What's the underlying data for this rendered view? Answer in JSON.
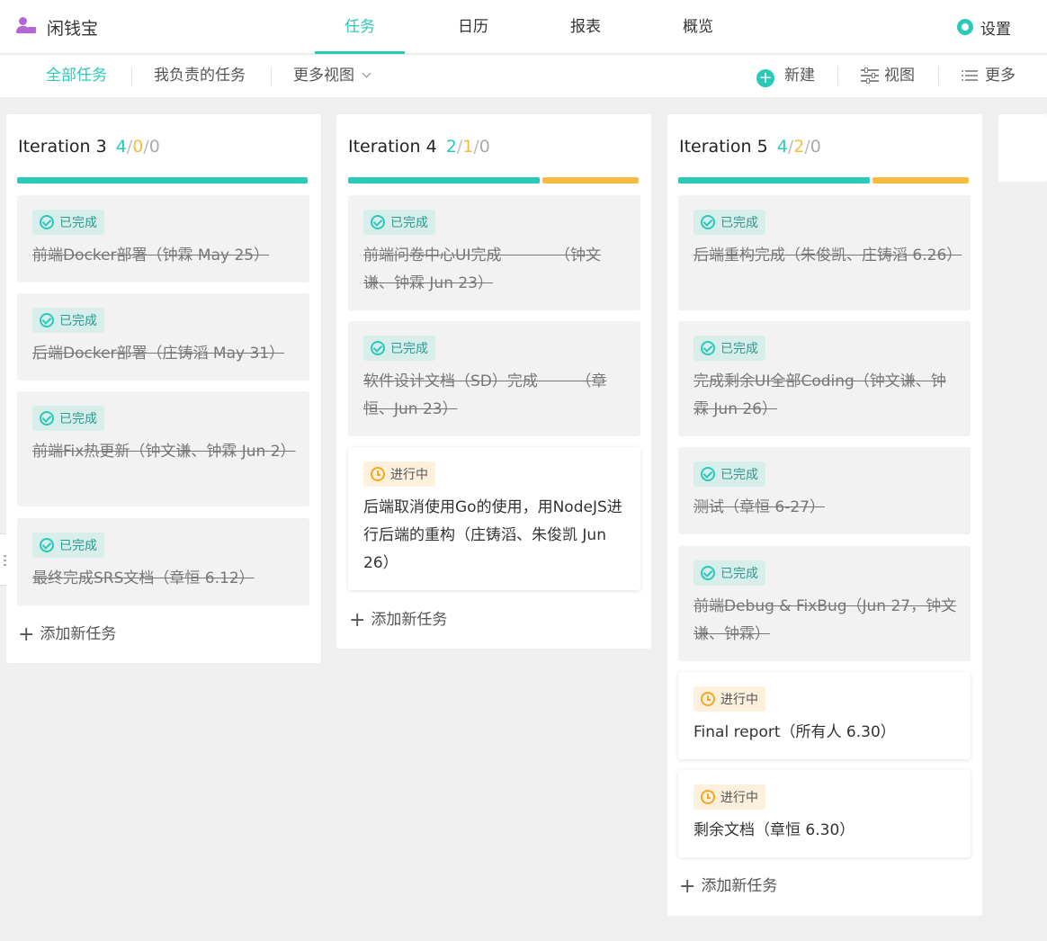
{
  "brand": {
    "name": "闲钱宝",
    "icon": "user-briefcase-icon"
  },
  "nav": {
    "tabs": [
      {
        "label": "任务",
        "active": true
      },
      {
        "label": "日历",
        "active": false
      },
      {
        "label": "报表",
        "active": false
      },
      {
        "label": "概览",
        "active": false
      }
    ],
    "settings_label": "设置"
  },
  "subnav": {
    "all_tasks": "全部任务",
    "my_tasks": "我负责的任务",
    "more_views": "更多视图",
    "new_label": "新建",
    "view_label": "视图",
    "more_label": "更多"
  },
  "colors": {
    "accent": "#2ac9b8",
    "in_progress": "#f7bb3f",
    "todo": "#aaaaaa",
    "brand": "#b565d8"
  },
  "columns": [
    {
      "title": "Iteration 3",
      "counts": {
        "done": "4",
        "in_progress": "0",
        "todo": "0"
      },
      "progress": {
        "done_fraction": 1.0,
        "in_progress_fraction": 0.0
      },
      "cards": [
        {
          "status": "已完成",
          "text": "前端Docker部署（钟霖 May 25）"
        },
        {
          "status": "已完成",
          "text": "后端Docker部署（庄铸滔 May 31）"
        },
        {
          "status": "已完成",
          "text": "前端Fix热更新（钟文谦、钟霖 Jun 2）"
        },
        {
          "status": "已完成",
          "text": "最终完成SRS文档（章恒 6.12）"
        }
      ],
      "add_label": "添加新任务"
    },
    {
      "title": "Iteration 4",
      "counts": {
        "done": "2",
        "in_progress": "1",
        "todo": "0"
      },
      "progress": {
        "done_fraction": 0.667,
        "in_progress_fraction": 0.333
      },
      "cards": [
        {
          "status": "已完成",
          "text": "前端问卷中心UI完成　　　　（钟文谦、钟霖 Jun 23）"
        },
        {
          "status": "已完成",
          "text": "软件设计文档（SD）完成　　　（章恒、Jun 23）"
        },
        {
          "status": "进行中",
          "text": "后端取消使用Go的使用，用NodeJS进行后端的重构（庄铸滔、朱俊凯 Jun 26）"
        }
      ],
      "add_label": "添加新任务"
    },
    {
      "title": "Iteration 5",
      "counts": {
        "done": "4",
        "in_progress": "2",
        "todo": "0"
      },
      "progress": {
        "done_fraction": 0.667,
        "in_progress_fraction": 0.333
      },
      "cards": [
        {
          "status": "已完成",
          "text": "后端重构完成（朱俊凯、庄铸滔 6.26）"
        },
        {
          "status": "已完成",
          "text": "完成剩余UI全部Coding（钟文谦、钟霖 Jun 26）"
        },
        {
          "status": "已完成",
          "text": "测试（章恒 6-27）"
        },
        {
          "status": "已完成",
          "text": "前端Debug & FixBug（Jun 27，钟文谦、钟霖）"
        },
        {
          "status": "进行中",
          "text": "Final report（所有人 6.30）"
        },
        {
          "status": "进行中",
          "text": "剩余文档（章恒 6.30）"
        }
      ],
      "add_label": "添加新任务"
    }
  ]
}
